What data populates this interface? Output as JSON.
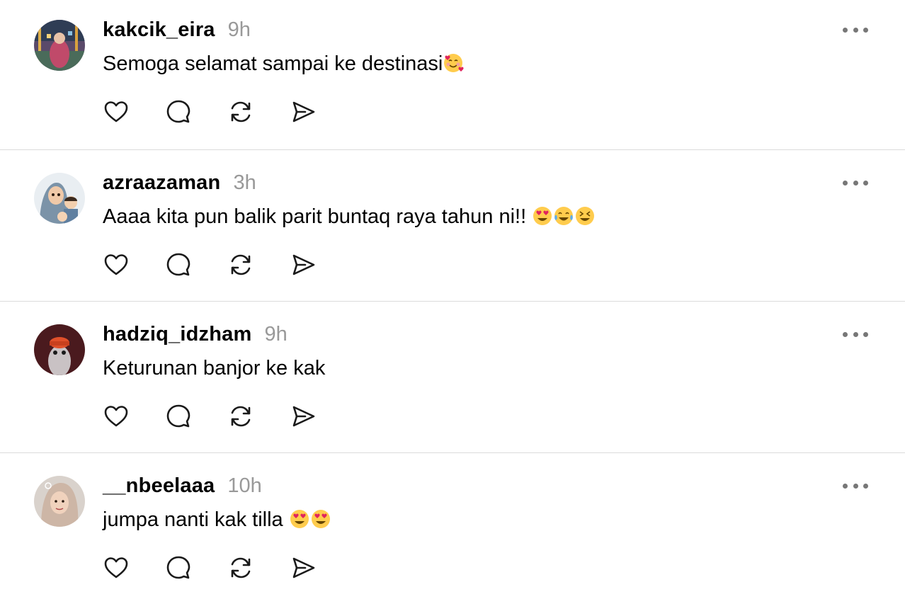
{
  "posts": [
    {
      "username": "kakcik_eira",
      "time": "9h",
      "text": "Semoga selamat sampai ke destinasi",
      "emojis": [
        "smiling-face-with-hearts"
      ]
    },
    {
      "username": "azraazaman",
      "time": "3h",
      "text": "Aaaa kita pun balik parit buntaq raya tahun ni!! ",
      "emojis": [
        "heart-eyes",
        "tears-of-joy",
        "grinning-squinting"
      ]
    },
    {
      "username": "hadziq_idzham",
      "time": "9h",
      "text": "Keturunan banjor ke kak",
      "emojis": []
    },
    {
      "username": "__nbeelaaa",
      "time": "10h",
      "text": "jumpa nanti kak tilla ",
      "emojis": [
        "heart-eyes",
        "heart-eyes"
      ]
    }
  ],
  "icons": {
    "like": "heart-icon",
    "reply": "comment-icon",
    "repost": "repost-icon",
    "share": "send-icon",
    "more": "more-horizontal-icon"
  },
  "colors": {
    "text": "#000000",
    "muted": "#999999",
    "divider": "#dbdbdb",
    "icon": "#1a1a1a"
  }
}
